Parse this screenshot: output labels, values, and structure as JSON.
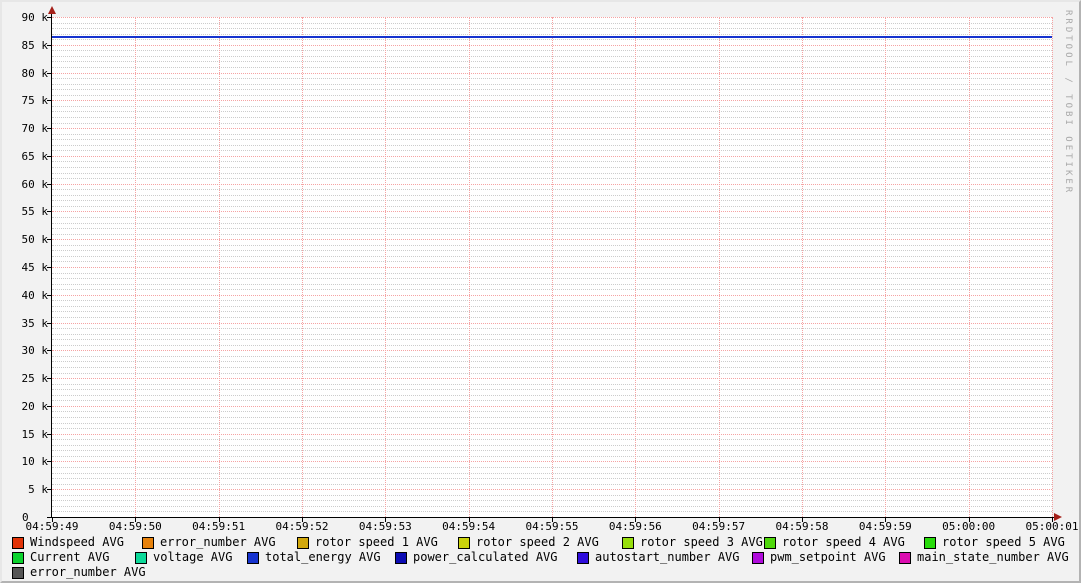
{
  "watermark": "RRDTOOL / TOBI OETIKER",
  "colors": {
    "background": "#F2F2F2",
    "plot_background": "#FFFFFF",
    "grid_minor": "#CCCCCC",
    "grid_major": "#F5A3A3",
    "axis": "#000000",
    "arrow": "#A52019",
    "text": "#000000",
    "watermark_text": "#A8A8A8"
  },
  "chart_data": {
    "type": "line",
    "title": "",
    "xlabel": "",
    "ylabel": "",
    "grid": true,
    "legend_position": "bottom",
    "ylim": [
      0,
      90000
    ],
    "y_major_step": 5000,
    "y_minor_step": 1000,
    "y_tick_labels": [
      "0",
      "5 k",
      "10 k",
      "15 k",
      "20 k",
      "25 k",
      "30 k",
      "35 k",
      "40 k",
      "45 k",
      "50 k",
      "55 k",
      "60 k",
      "65 k",
      "70 k",
      "75 k",
      "80 k",
      "85 k",
      "90 k"
    ],
    "x_tick_labels": [
      "04:59:49",
      "04:59:50",
      "04:59:51",
      "04:59:52",
      "04:59:53",
      "04:59:54",
      "04:59:55",
      "04:59:56",
      "04:59:57",
      "04:59:58",
      "04:59:59",
      "05:00:00",
      "05:00:01"
    ],
    "series": [
      {
        "name": "total_energy AVG",
        "color": "#1633CF",
        "values": [
          86400,
          86400,
          86400,
          86400,
          86400,
          86400,
          86400,
          86400,
          86400,
          86400,
          86400,
          86400,
          86400
        ]
      }
    ]
  },
  "legend": {
    "rows": [
      [
        {
          "label": "Windspeed AVG",
          "color": "#E23408"
        },
        {
          "label": "error_number AVG",
          "color": "#E7820C"
        },
        {
          "label": "rotor speed 1 AVG",
          "color": "#D2A80C"
        },
        {
          "label": "rotor speed 2 AVG",
          "color": "#CBD30C"
        },
        {
          "label": "rotor speed 3 AVG",
          "color": "#97DE0C"
        },
        {
          "label": "rotor speed 4 AVG",
          "color": "#4FD80C"
        },
        {
          "label": "rotor speed 5 AVG",
          "color": "#28DC0C"
        }
      ],
      [
        {
          "label": "Current AVG",
          "color": "#0CD32E"
        },
        {
          "label": "voltage AVG",
          "color": "#0CD999"
        },
        {
          "label": "total_energy AVG",
          "color": "#1633CF"
        },
        {
          "label": "power_calculated AVG",
          "color": "#0C0CB4"
        },
        {
          "label": "autostart_number AVG",
          "color": "#2F0CDC"
        },
        {
          "label": "pwm_setpoint AVG",
          "color": "#B00CDC"
        },
        {
          "label": "main_state_number AVG",
          "color": "#DC0CB0"
        }
      ],
      [
        {
          "label": "error_number AVG",
          "color": "#555555"
        }
      ]
    ]
  }
}
